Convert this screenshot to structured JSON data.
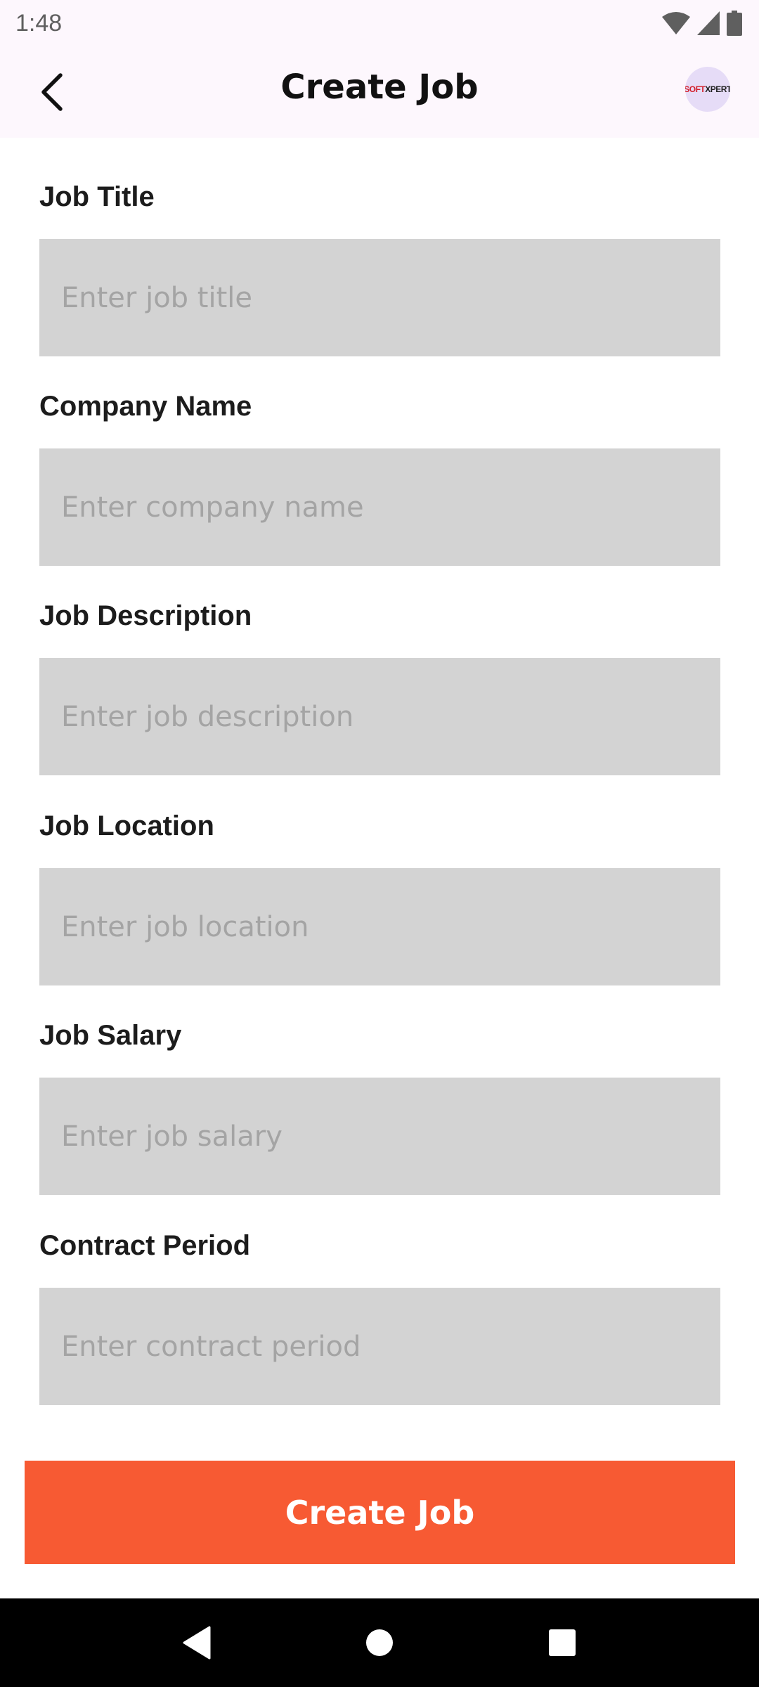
{
  "status_bar": {
    "time": "1:48",
    "icons": [
      "wifi-icon",
      "signal-icon",
      "battery-icon"
    ]
  },
  "app_bar": {
    "title": "Create Job",
    "back_icon": "back-arrow-icon",
    "logo_text_accent": "SOFT",
    "logo_text": "XPERT"
  },
  "form": {
    "fields": [
      {
        "label": "Job Title",
        "placeholder": "Enter job title",
        "value": ""
      },
      {
        "label": "Company Name",
        "placeholder": "Enter company name",
        "value": ""
      },
      {
        "label": "Job Description",
        "placeholder": "Enter job description",
        "value": ""
      },
      {
        "label": "Job Location",
        "placeholder": "Enter job location",
        "value": ""
      },
      {
        "label": "Job Salary",
        "placeholder": "Enter job salary",
        "value": ""
      },
      {
        "label": "Contract Period",
        "placeholder": "Enter contract period",
        "value": ""
      }
    ],
    "submit_label": "Create Job"
  },
  "colors": {
    "accent": "#f75a33",
    "input_bg": "#d3d3d3",
    "app_bar_bg": "#fdf7fd"
  },
  "nav_bar": {
    "icons": [
      "nav-back-icon",
      "nav-home-icon",
      "nav-recents-icon"
    ]
  }
}
